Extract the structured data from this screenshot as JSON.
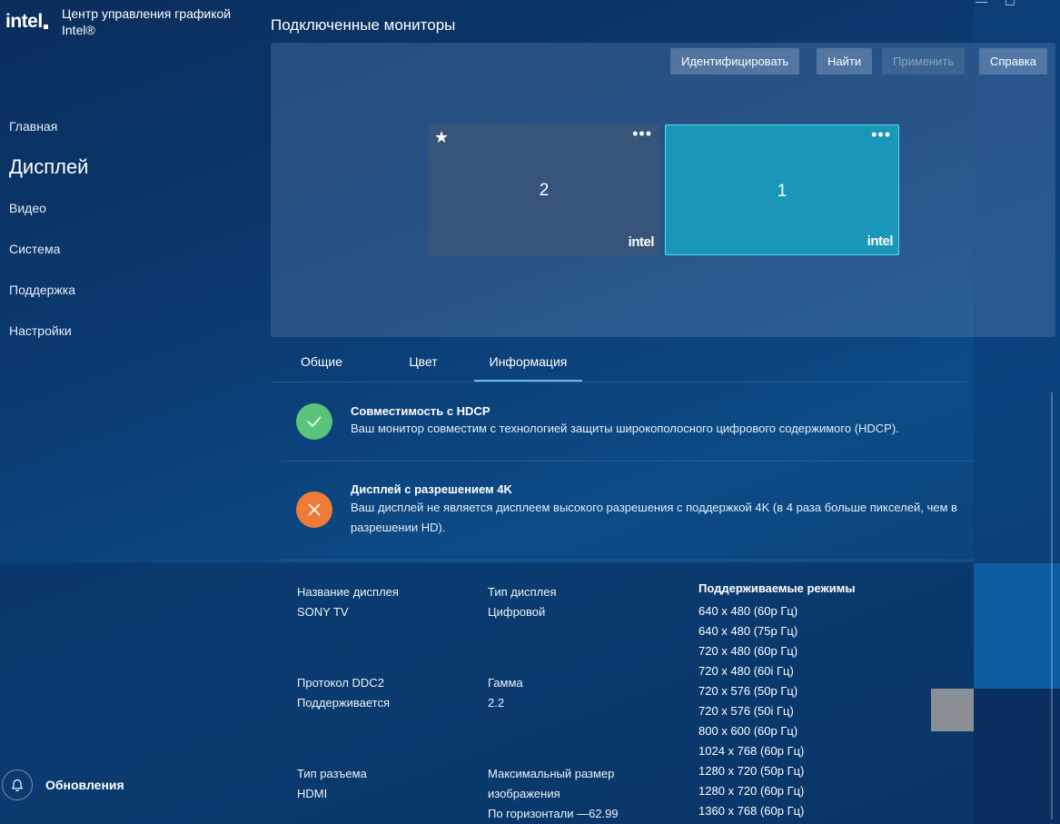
{
  "app": {
    "brand": "intel",
    "title_line1": "Центр управления графикой",
    "title_line2": "Intel®"
  },
  "sidebar": {
    "items": [
      {
        "label": "Главная"
      },
      {
        "label": "Дисплей"
      },
      {
        "label": "Видео"
      },
      {
        "label": "Система"
      },
      {
        "label": "Поддержка"
      },
      {
        "label": "Настройки"
      }
    ],
    "updates_label": "Обновления"
  },
  "section_title": "Подключенные мониторы",
  "toolbar": {
    "identify": "Идентифицировать",
    "find": "Найти",
    "apply": "Применить",
    "help": "Справка"
  },
  "monitors": [
    {
      "number": "2",
      "logo": "intel",
      "primary_star": "★"
    },
    {
      "number": "1",
      "logo": "intel"
    }
  ],
  "tabs": [
    {
      "label": "Общие"
    },
    {
      "label": "Цвет"
    },
    {
      "label": "Информация"
    }
  ],
  "hdcp": {
    "title": "Совместимость с HDCP",
    "text": "Ваш монитор совместим с технологией защиты широкополосного цифрового содержимого (HDCP).",
    "status_color": "#5ac47a"
  },
  "uhd": {
    "title": "Дисплей с разрешением 4K",
    "text": "Ваш дисплей не является дисплеем высокого разрешения с поддержкой 4K (в 4 раза больше пикселей, чем в разрешении HD).",
    "status_color": "#f07b37"
  },
  "details": {
    "display_name_label": "Название дисплея",
    "display_name_value": "SONY TV",
    "display_type_label": "Тип дисплея",
    "display_type_value": "Цифровой",
    "ddc2_label": "Протокол DDC2",
    "ddc2_value": "Поддерживается",
    "gamma_label": "Гамма",
    "gamma_value": "2.2",
    "connector_label": "Тип разъема",
    "connector_value": "HDMI",
    "max_size_label_1": "Максимальный размер",
    "max_size_label_2": "изображения",
    "max_size_value": "По горизонтали —62.99"
  },
  "modes": {
    "title": "Поддерживаемые режимы",
    "items": [
      "640 x 480 (60p Гц)",
      "640 x 480 (75p Гц)",
      "720 x 480 (60p Гц)",
      "720 x 480 (60i Гц)",
      "720 x 576 (50p Гц)",
      "720 x 576 (50i Гц)",
      "800 x 600 (60p Гц)",
      "1024 x 768 (60p Гц)",
      "1280 x 720 (50p Гц)",
      "1280 x 720 (60p Гц)",
      "1360 x 768 (60p Гц)"
    ]
  },
  "window_controls": {
    "minimize": "—",
    "maximize": "☐"
  }
}
